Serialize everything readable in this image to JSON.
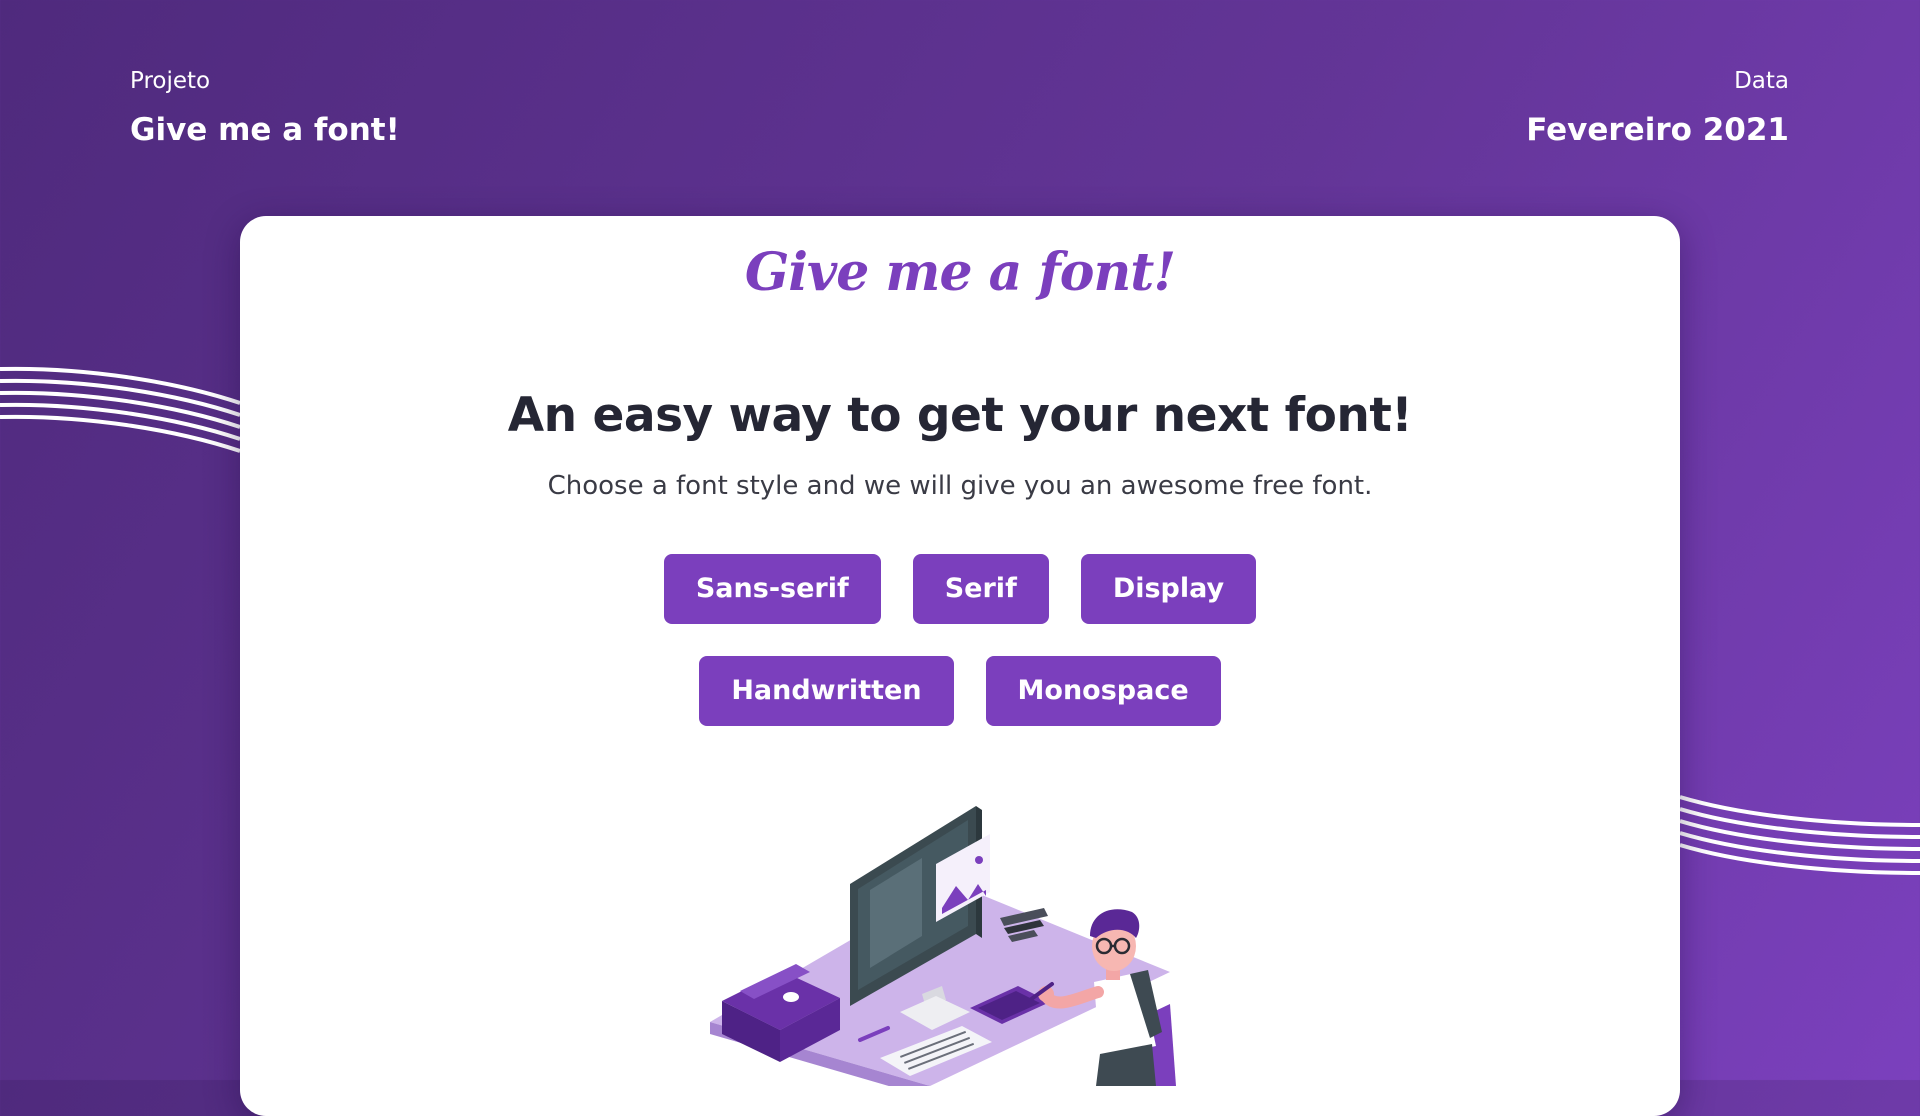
{
  "header": {
    "left": {
      "label": "Projeto",
      "value": "Give me a font!"
    },
    "right": {
      "label": "Data",
      "value": "Fevereiro 2021"
    }
  },
  "card": {
    "brand": "Give me a font!",
    "headline": "An easy way to get your next font!",
    "subtitle": "Choose a font style and we will give you an awesome free font.",
    "buttons": [
      "Sans-serif",
      "Serif",
      "Display",
      "Handwritten",
      "Monospace"
    ]
  },
  "colors": {
    "background_start": "#4f2a7d",
    "background_end": "#7b40bd",
    "accent": "#7b3fbd",
    "headline": "#252634",
    "card": "#ffffff"
  },
  "illustration": {
    "icon": "designer-at-desk-illustration"
  }
}
